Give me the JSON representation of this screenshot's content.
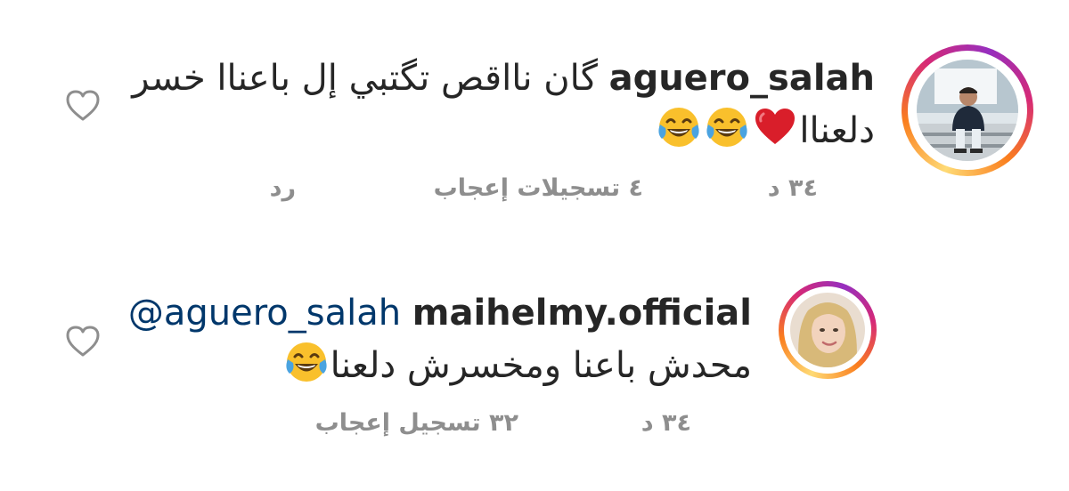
{
  "comments": [
    {
      "username": "aguero_salah",
      "text_line1": "گان نااقص تگتبي إل باعناا خسر",
      "text_line2": "دلعناا",
      "emoji_heart": "red-heart-icon",
      "emoji_laugh": "face-with-tears-of-joy-icon",
      "time": "٣٤ د",
      "likes": "٤ تسجيلات إعجاب",
      "reply": "رد"
    },
    {
      "username": "maihelmy.official",
      "mention": "@aguero_salah",
      "text_line2": "محدش باعنا ومخسرش دلعنا",
      "emoji_laugh": "face-with-tears-of-joy-icon",
      "time": "٣٤ د",
      "likes": "٣٢ تسجيل إعجاب"
    }
  ],
  "colors": {
    "text": "#262626",
    "meta": "#8e8e8e",
    "mention": "#00376b",
    "heart_outline": "#8e8e8e"
  }
}
